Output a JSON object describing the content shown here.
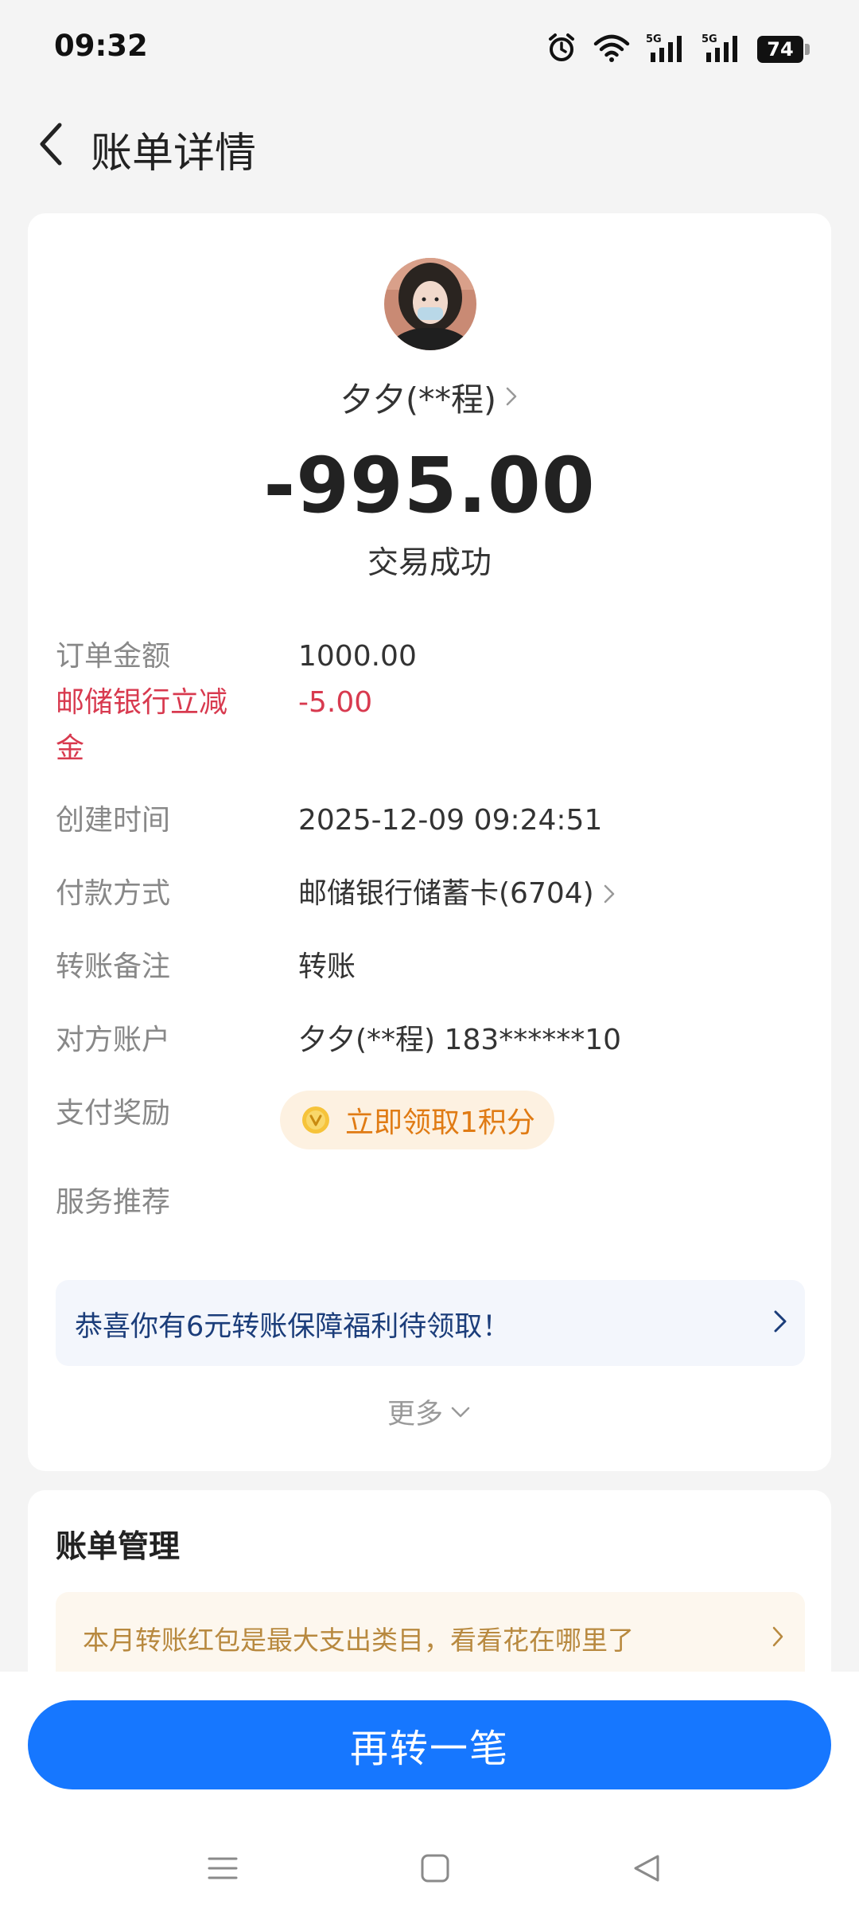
{
  "status_bar": {
    "time": "09:32",
    "battery": "74",
    "network": [
      "5G",
      "5G"
    ]
  },
  "header": {
    "title": "账单详情"
  },
  "payee": {
    "name": "夕夕(**程)",
    "amount": "-995.00",
    "status": "交易成功"
  },
  "details": {
    "order_amount_label": "订单金额",
    "order_amount_value": "1000.00",
    "discount_label": "邮储银行立减金",
    "discount_value": "-5.00",
    "created_label": "创建时间",
    "created_value": "2025-12-09 09:24:51",
    "payment_label": "付款方式",
    "payment_value": "邮储银行储蓄卡(6704)",
    "note_label": "转账备注",
    "note_value": "转账",
    "counterparty_label": "对方账户",
    "counterparty_value": "夕夕(**程) 183******10",
    "reward_label": "支付奖励",
    "reward_value": "立即领取1积分",
    "service_label": "服务推荐"
  },
  "promo": {
    "text": "恭喜你有6元转账保障福利待领取！"
  },
  "more": {
    "label": "更多"
  },
  "bill_management": {
    "title": "账单管理",
    "tip": "本月转账红包是最大支出类目，看看花在哪里了"
  },
  "cta": {
    "label": "再转一笔"
  },
  "colors": {
    "primary": "#1677ff",
    "discount_red": "#d83a4f",
    "reward_orange": "#e07b14",
    "promo_blue": "#1b3d7a"
  }
}
